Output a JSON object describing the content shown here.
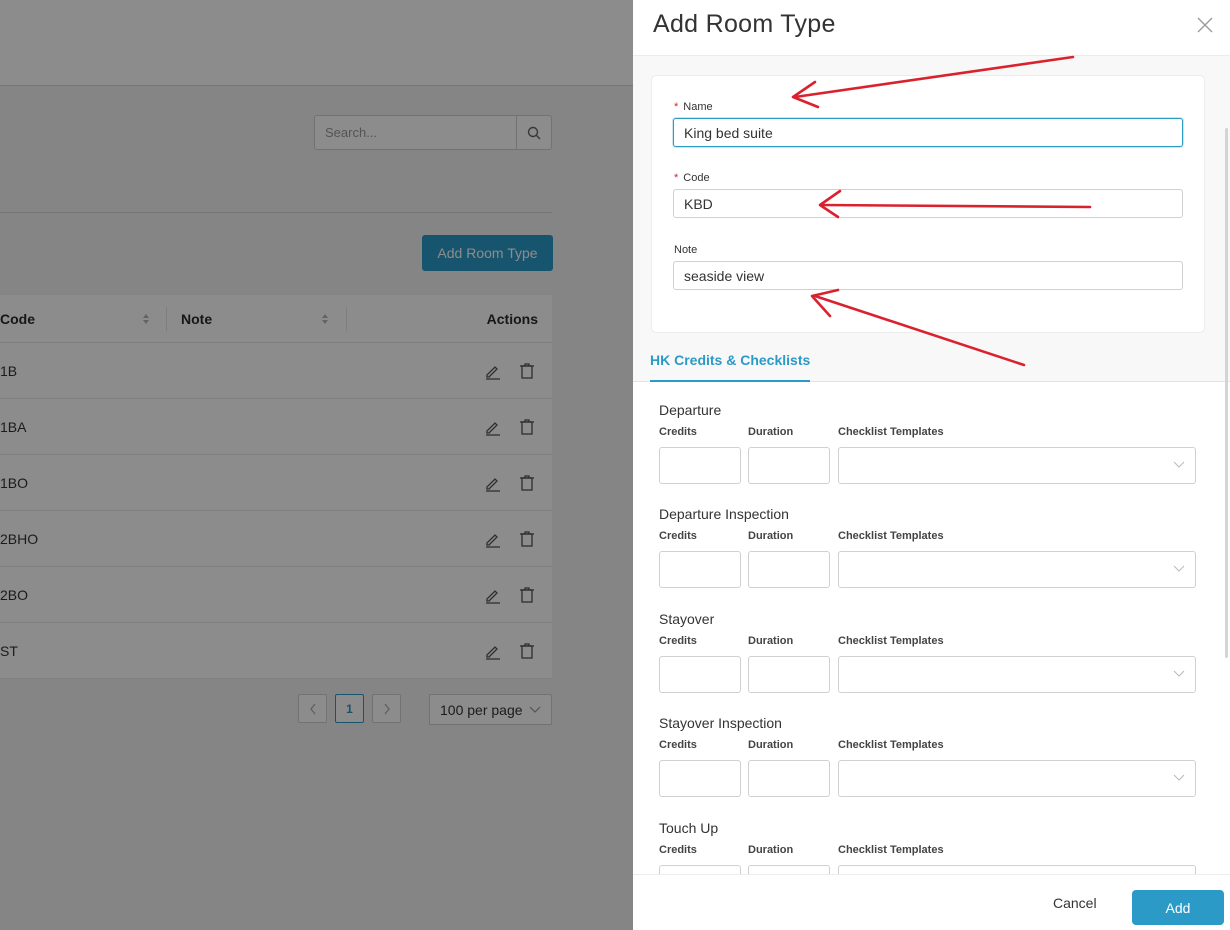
{
  "background_page": {
    "search": {
      "placeholder": "Search..."
    },
    "add_button_label": "Add Room Type",
    "table": {
      "columns": [
        "Code",
        "Note",
        "Actions"
      ],
      "rows": [
        {
          "code": "1B"
        },
        {
          "code": "1BA"
        },
        {
          "code": "1BO"
        },
        {
          "code": "2BHO"
        },
        {
          "code": "2BO"
        },
        {
          "code": "ST"
        }
      ]
    },
    "pagination": {
      "current_page": "1",
      "per_page": "100 per page",
      "prev_icon": "chevron-left-icon",
      "next_icon": "chevron-right-icon"
    }
  },
  "drawer": {
    "title": "Add Room Type",
    "fields": {
      "name": {
        "label": "Name",
        "value": "King bed suite",
        "required": true
      },
      "code": {
        "label": "Code",
        "value": "KBD",
        "required": true
      },
      "note": {
        "label": "Note",
        "value": "seaside view",
        "required": false
      }
    },
    "tab_label": "HK Credits & Checklists",
    "col_labels": {
      "credits": "Credits",
      "duration": "Duration",
      "templates": "Checklist Templates"
    },
    "sections": [
      {
        "title": "Departure"
      },
      {
        "title": "Departure Inspection"
      },
      {
        "title": "Stayover"
      },
      {
        "title": "Stayover Inspection"
      },
      {
        "title": "Touch Up"
      }
    ],
    "footer": {
      "cancel_label": "Cancel",
      "add_label": "Add"
    }
  },
  "colors": {
    "accent": "#2b9ac7",
    "required": "#d9222e",
    "annotation_arrow": "#d9222e"
  }
}
